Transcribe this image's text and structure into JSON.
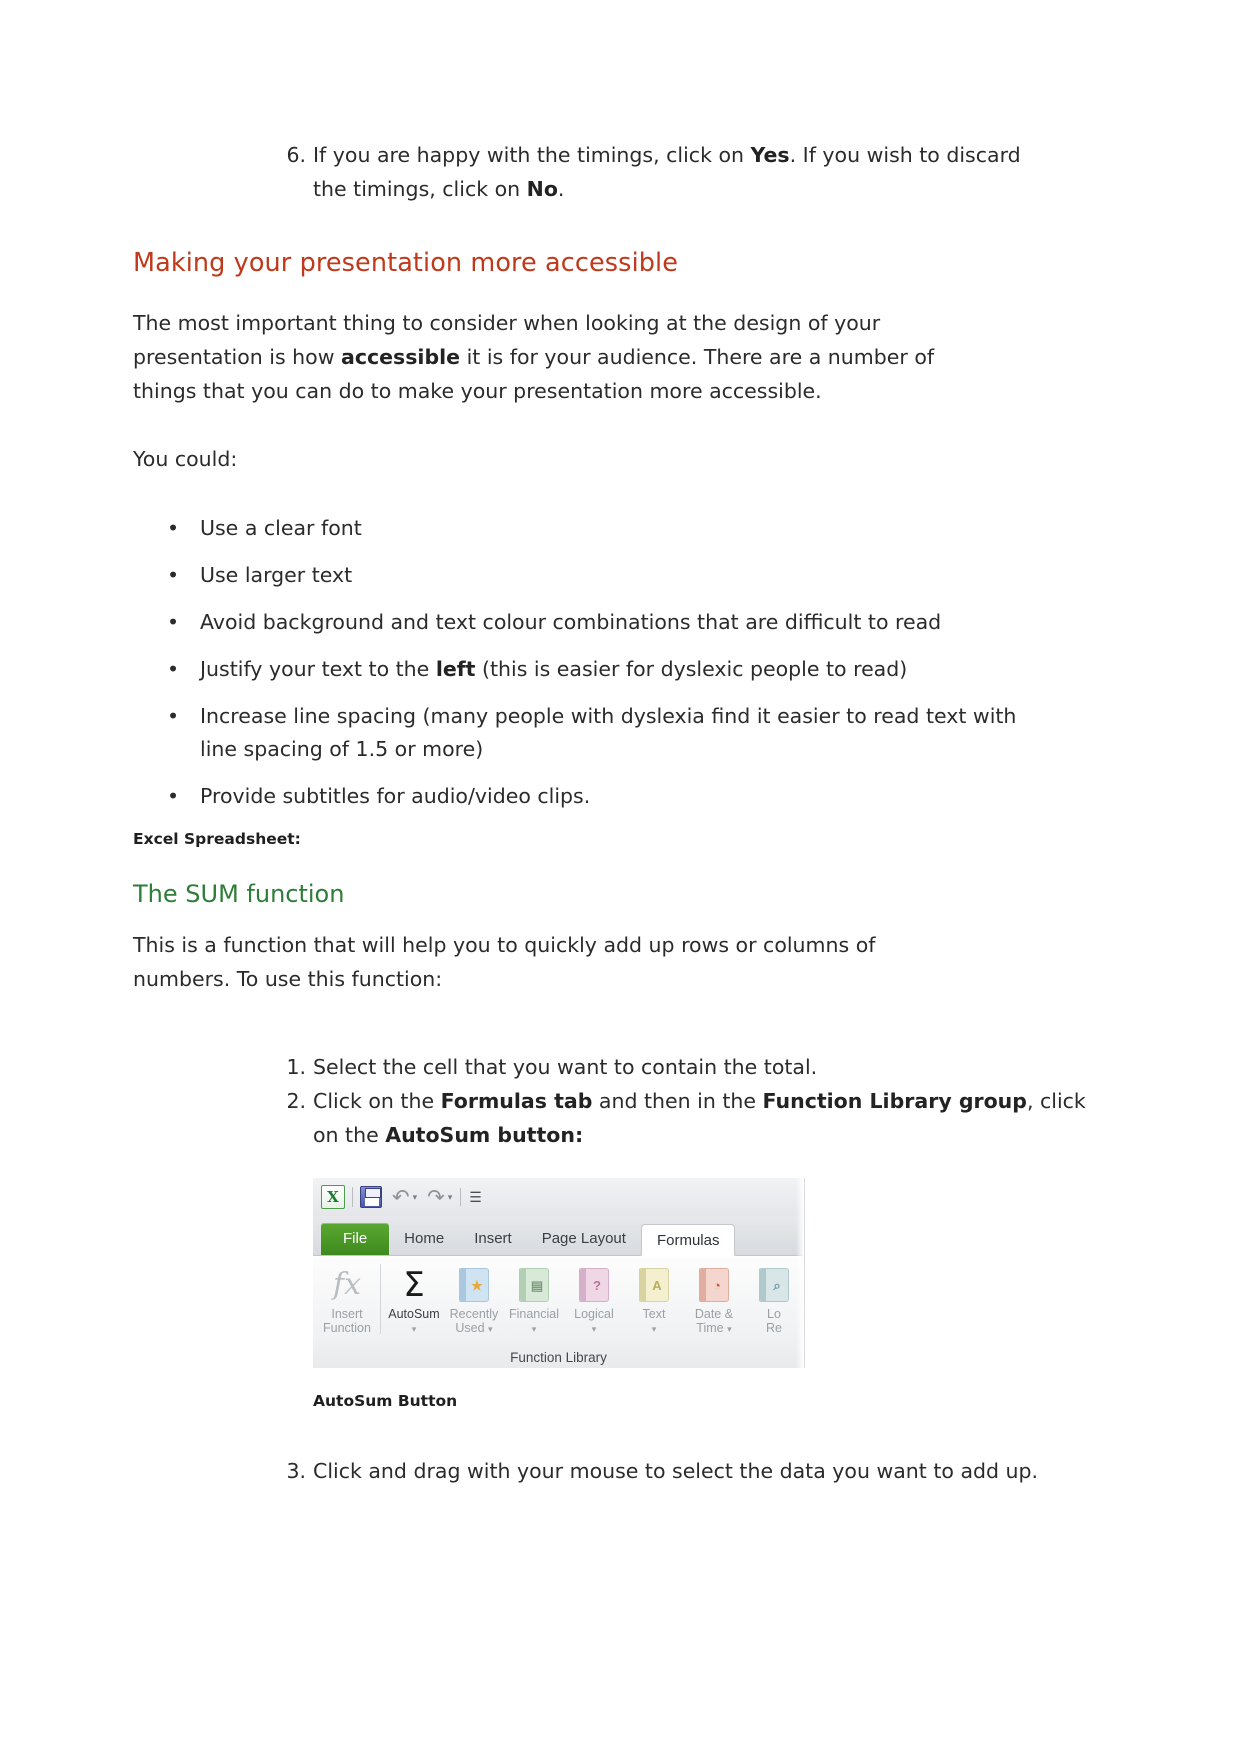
{
  "top_list": {
    "items": [
      {
        "marker": "6.",
        "line1_a": "If you are happy with the timings, click on ",
        "line1_bold": "Yes",
        "line1_b": ". If you wish to discard",
        "line2_a": "the timings, click on ",
        "line2_bold": "No",
        "line2_b": "."
      }
    ]
  },
  "accessible_section": {
    "heading": "Making your presentation more accessible",
    "paragraph_a": "The most important thing to consider when looking at the design of your presentation is how ",
    "paragraph_bold": "accessible",
    "paragraph_b": " it is for your audience. There are a number of things that you can do to make your presentation more accessible.",
    "lead_in": "You could:",
    "bullet_char": "•",
    "bullets": [
      {
        "text": "Use a clear font"
      },
      {
        "text": "Use larger text"
      },
      {
        "text": "Avoid background and text colour combinations that are difficult to read"
      },
      {
        "pre": "Justify your text to the ",
        "bold": "left",
        "post": " (this is easier for dyslexic people to read)"
      },
      {
        "text": "Increase line spacing (many people with dyslexia find it easier to read text with line spacing of 1.5 or more)"
      },
      {
        "text": "Provide subtitles for audio/video clips."
      }
    ]
  },
  "excel_section": {
    "label": "Excel Spreadsheet:",
    "heading": "The SUM function",
    "intro": "This is a function that will help you to quickly add up rows or columns of numbers. To use this function:",
    "steps": [
      {
        "marker": "1.",
        "text": "Select the cell that you want to contain the total."
      },
      {
        "marker": "2.",
        "pre": "Click on the ",
        "bold1": "Formulas tab",
        "mid": " and then in the ",
        "bold2": "Function Library group",
        "post": ", click on the ",
        "bold3": "AutoSum button:"
      },
      {
        "marker": "3.",
        "text": "Click and drag with your mouse to select the data you want to add up."
      }
    ],
    "image_caption": "AutoSum Button"
  },
  "ribbon": {
    "quick_access": {
      "app_icon_label": "X",
      "save_icon": "save-icon",
      "undo_icon": "undo-arrow-icon",
      "redo_icon": "redo-arrow-icon",
      "customize_icon": "customize-toolbar-icon",
      "undo_glyph": "↶",
      "redo_glyph": "↷",
      "caret_glyph": "▾",
      "customize_glyph": "☰"
    },
    "tabs": [
      {
        "label": "File",
        "state": "file"
      },
      {
        "label": "Home",
        "state": "normal"
      },
      {
        "label": "Insert",
        "state": "normal"
      },
      {
        "label": "Page Layout",
        "state": "normal"
      },
      {
        "label": "Formulas",
        "state": "active"
      }
    ],
    "group_caption": "Function Library",
    "buttons": [
      {
        "label_line1": "Insert",
        "label_line2": "Function",
        "glyph": "fx",
        "icon": "insert-function-icon",
        "dropdown": false,
        "enabled": false
      },
      {
        "label_line1": "AutoSum",
        "label_line2": "",
        "glyph": "Σ",
        "icon": "autosum-sigma-icon",
        "dropdown": true,
        "enabled": true
      },
      {
        "label_line1": "Recently",
        "label_line2": "Used",
        "glyph": "★",
        "icon": "recently-used-icon",
        "dropdown": true,
        "enabled": false
      },
      {
        "label_line1": "Financial",
        "label_line2": "",
        "glyph": "▤",
        "icon": "financial-icon",
        "dropdown": true,
        "enabled": false
      },
      {
        "label_line1": "Logical",
        "label_line2": "",
        "glyph": "?",
        "icon": "logical-icon",
        "dropdown": true,
        "enabled": false
      },
      {
        "label_line1": "Text",
        "label_line2": "",
        "glyph": "A",
        "icon": "text-icon",
        "dropdown": true,
        "enabled": false
      },
      {
        "label_line1": "Date &",
        "label_line2": "Time",
        "glyph": "◔",
        "icon": "date-time-icon",
        "dropdown": true,
        "enabled": false
      },
      {
        "label_line1": "Lo",
        "label_line2": "Re",
        "glyph": "⌕",
        "icon": "lookup-reference-icon",
        "dropdown": false,
        "enabled": false
      }
    ]
  },
  "colors": {
    "red_heading": "#c0391b",
    "green_heading": "#2e7d38",
    "body_text": "#2b2b2b",
    "excel_file_tab": "#3e8a1e"
  }
}
